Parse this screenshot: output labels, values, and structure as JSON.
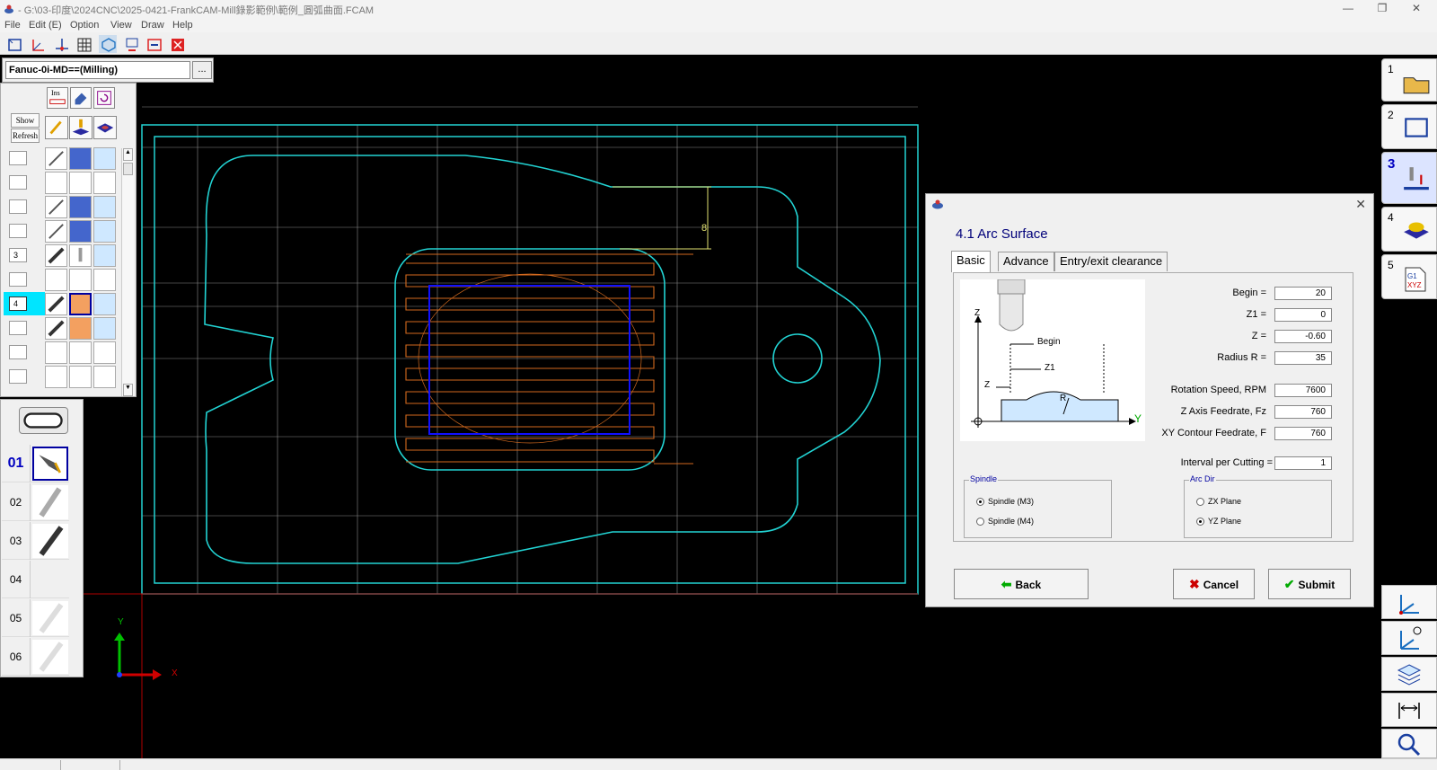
{
  "window": {
    "title": "- G:\\03-印度\\2024CNC\\2025-0421-FrankCAM-Mill錄影範例\\範例_圓弧曲面.FCAM",
    "minimize": "—",
    "maximize": "❐",
    "close": "✕"
  },
  "menu": [
    "File",
    "Edit (E)",
    "Option",
    "View",
    "Draw",
    "Help"
  ],
  "machine": {
    "value": "Fanuc-0i-MD==(Milling)",
    "browse_label": "..."
  },
  "op_panel": {
    "show_label": "Show",
    "refresh_label": "Refresh",
    "ins_label": "Ins",
    "rows": [
      {
        "num": ""
      },
      {
        "num": ""
      },
      {
        "num": ""
      },
      {
        "num": ""
      },
      {
        "num": "3"
      },
      {
        "num": ""
      },
      {
        "num": "4"
      },
      {
        "num": ""
      },
      {
        "num": ""
      },
      {
        "num": ""
      }
    ]
  },
  "tools": [
    "01",
    "02",
    "03",
    "04",
    "05",
    "06"
  ],
  "right_steps": [
    "1",
    "2",
    "3",
    "4",
    "5"
  ],
  "canvas": {
    "axis_x": "X",
    "axis_y": "Y",
    "dim_label": "8"
  },
  "dialog": {
    "title": "4.1 Arc Surface",
    "tabs": [
      "Basic",
      "Advance",
      "Entry/exit clearance"
    ],
    "active_tab": "Basic",
    "diagram_labels": {
      "z_axis": "Z",
      "y_axis": "Y",
      "begin": "Begin",
      "z1": "Z1",
      "z": "Z",
      "r": "R"
    },
    "fields": {
      "begin": {
        "label": "Begin =",
        "value": "20"
      },
      "z1": {
        "label": "Z1 =",
        "value": "0"
      },
      "z": {
        "label": "Z =",
        "value": "-0.60"
      },
      "radius": {
        "label": "Radius R =",
        "value": "35"
      },
      "rpm": {
        "label": "Rotation Speed, RPM",
        "value": "7600"
      },
      "fz": {
        "label": "Z Axis Feedrate, Fz",
        "value": "760"
      },
      "f": {
        "label": "XY Contour Feedrate, F",
        "value": "760"
      },
      "interval": {
        "label": "Interval per Cutting =",
        "value": "1"
      }
    },
    "spindle": {
      "title": "Spindle",
      "options": [
        "Spindle (M3)",
        "Spindle (M4)"
      ],
      "selected": "Spindle (M3)"
    },
    "arc_dir": {
      "title": "Arc Dir",
      "options": [
        "ZX Plane",
        "YZ Plane"
      ],
      "selected": "YZ Plane"
    },
    "buttons": {
      "back": "Back",
      "cancel": "Cancel",
      "submit": "Submit"
    }
  },
  "colors": {
    "contour": "#22d3d3",
    "toolpath": "#d2691e",
    "rect": "#1010ff",
    "grid": "#9a9a9a",
    "dialog_title": "#00007a"
  }
}
